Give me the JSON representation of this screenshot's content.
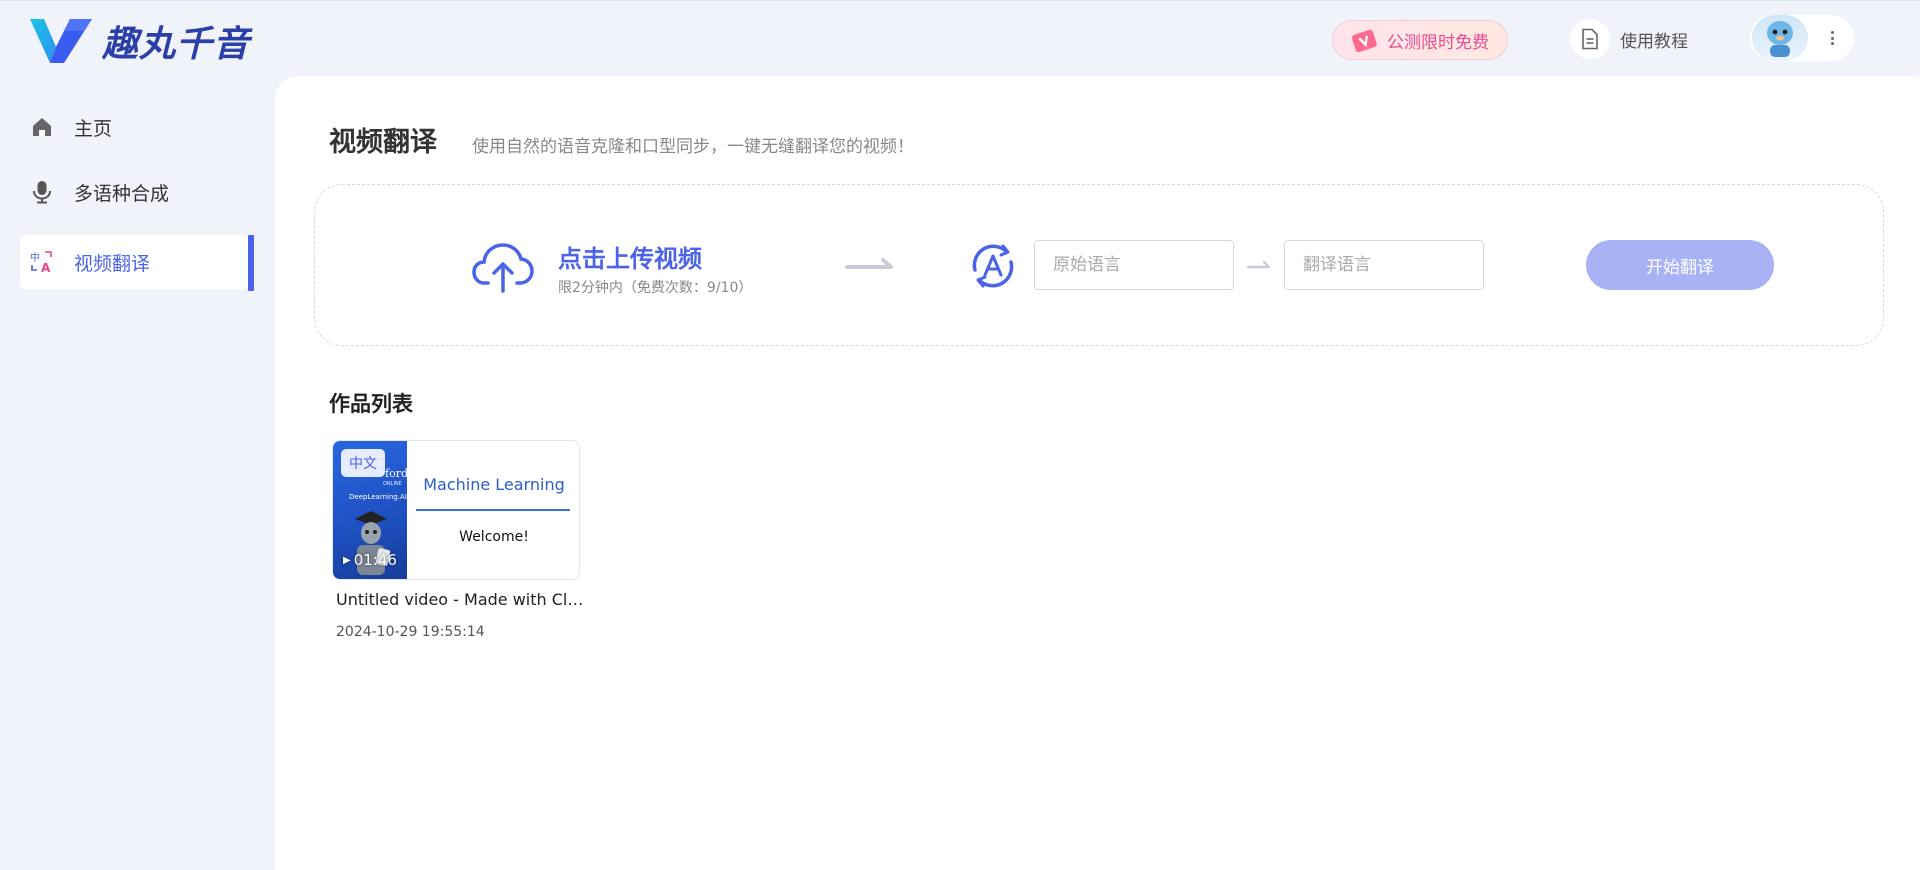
{
  "brand": {
    "name": "趣丸千音",
    "accent": "#4a63e8",
    "logo_colors": [
      "#18c1e0",
      "#3a5bf0"
    ]
  },
  "header": {
    "promo_label": "公测限时免费",
    "promo_icon": "ticket-icon",
    "tutorial_label": "使用教程",
    "tutorial_icon": "document-icon",
    "more_icon": "more-vertical-icon"
  },
  "sidebar": {
    "items": [
      {
        "label": "主页",
        "icon": "home-icon",
        "active": false
      },
      {
        "label": "多语种合成",
        "icon": "microphone-icon",
        "active": false
      },
      {
        "label": "视频翻译",
        "icon": "translate-icon",
        "active": true
      }
    ]
  },
  "main": {
    "title": "视频翻译",
    "subtitle": "使用自然的语音克隆和口型同步，一键无缝翻译您的视频！",
    "upload": {
      "title": "点击上传视频",
      "limit": "限2分钟内（免费次数：9/10）",
      "icon": "cloud-upload-icon"
    },
    "source_language": {
      "placeholder": "原始语言",
      "value": ""
    },
    "target_language": {
      "placeholder": "翻译语言",
      "value": ""
    },
    "start_button": "开始翻译",
    "works_title": "作品列表",
    "works": [
      {
        "language_badge": "中文",
        "duration": "01:46",
        "thumb_brand": "ford",
        "thumb_small_1": "ONLINE",
        "thumb_small_2": "DeepLearning.AI",
        "slide_title": "Machine Learning",
        "slide_text": "Welcome!",
        "title": "Untitled video - Made with Clipchamp",
        "date": "2024-10-29 19:55:14"
      }
    ]
  }
}
